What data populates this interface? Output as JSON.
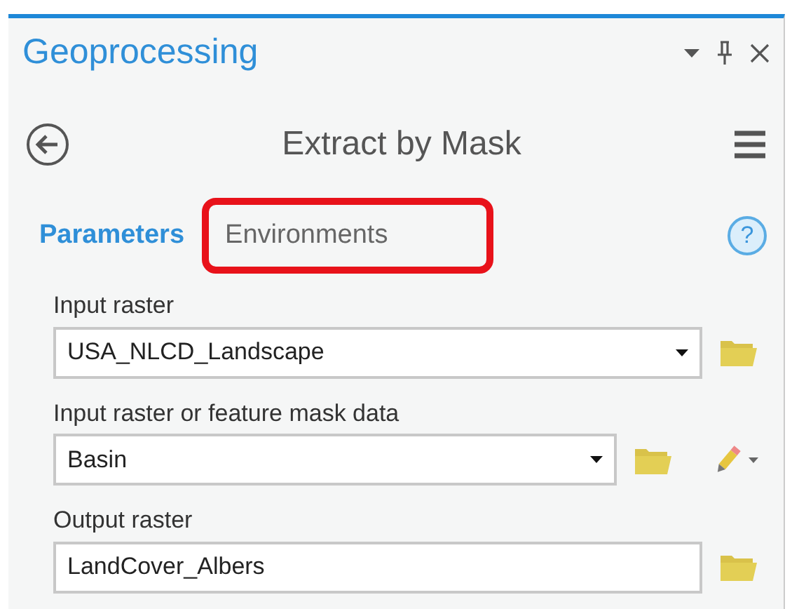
{
  "pane": {
    "title": "Geoprocessing"
  },
  "tool": {
    "title": "Extract by Mask"
  },
  "tabs": [
    {
      "label": "Parameters",
      "selected": true,
      "highlighted": false
    },
    {
      "label": "Environments",
      "selected": false,
      "highlighted": true
    }
  ],
  "help": {
    "label": "?"
  },
  "parameters": [
    {
      "label": "Input raster",
      "kind": "dropdown",
      "value": "USA_NLCD_Landscape",
      "drawable": false
    },
    {
      "label": "Input raster or feature mask data",
      "kind": "dropdown",
      "value": "Basin",
      "drawable": true
    },
    {
      "label": "Output raster",
      "kind": "text",
      "value": "LandCover_Albers",
      "drawable": false
    }
  ]
}
